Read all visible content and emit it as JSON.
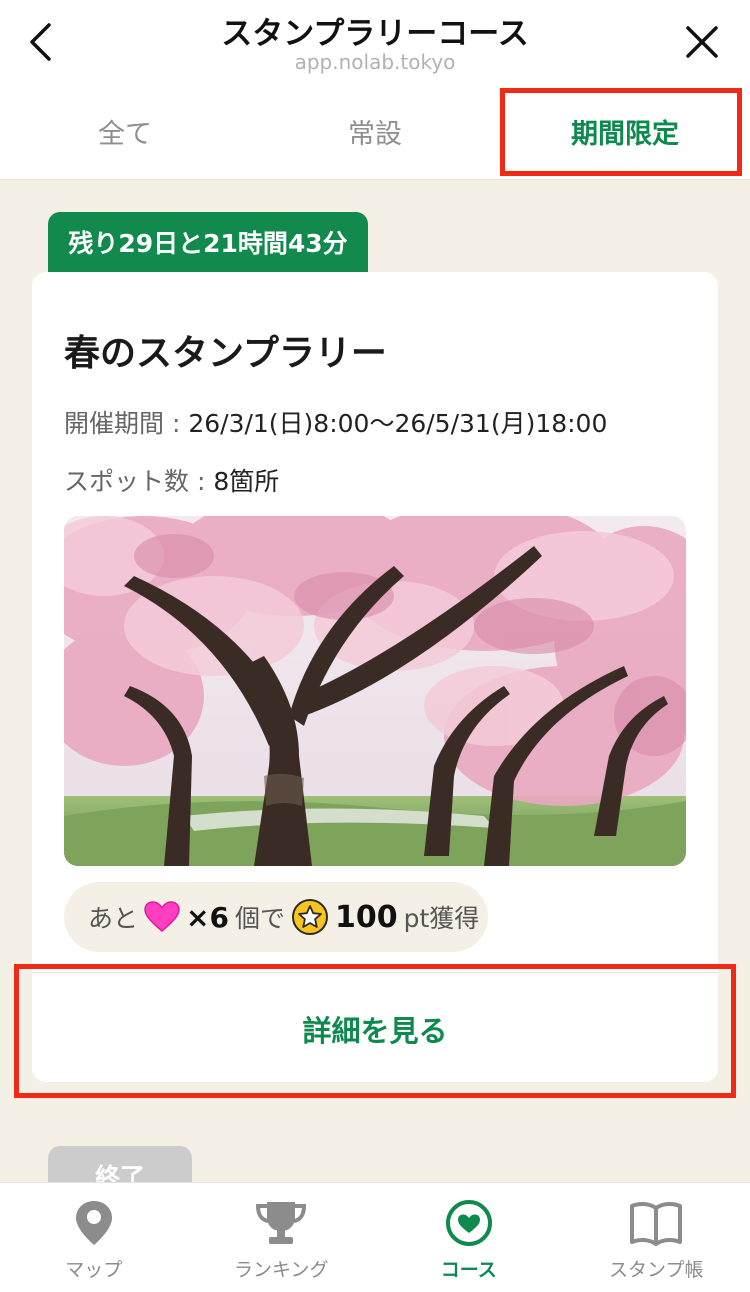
{
  "header": {
    "title": "スタンプラリーコース",
    "url": "app.nolab.tokyo",
    "back_icon": "chevron-left-icon",
    "close_icon": "close-icon"
  },
  "tabs": [
    {
      "label": "全て",
      "active": false
    },
    {
      "label": "常設",
      "active": false
    },
    {
      "label": "期間限定",
      "active": true
    }
  ],
  "course": {
    "remaining": "残り29日と21時間43分",
    "title": "春のスタンプラリー",
    "period_label": "開催期間 : ",
    "period_value": "26/3/1(日)8:00〜26/5/31(月)18:00",
    "spots_label": "スポット数 : ",
    "spots_value": "8箇所",
    "image": "cherry-blossom-trees-photo",
    "reward": {
      "prefix": "あと",
      "heart_count": "×6",
      "middle": "個で",
      "points": "100",
      "suffix": "pt獲得"
    },
    "details_button": "詳細を見る"
  },
  "next_course": {
    "status": "終了"
  },
  "bottom_nav": [
    {
      "label": "マップ",
      "icon": "map-pin-icon",
      "active": false
    },
    {
      "label": "ランキング",
      "icon": "trophy-icon",
      "active": false
    },
    {
      "label": "コース",
      "icon": "heart-circle-icon",
      "active": true
    },
    {
      "label": "スタンプ帳",
      "icon": "book-icon",
      "active": false
    }
  ],
  "colors": {
    "accent_green": "#0f8a4f",
    "badge_green": "#128a4e",
    "background": "#f5f0e6",
    "highlight_red": "#f02a14",
    "heart_pink": "#ff3fc0",
    "coin_yellow": "#f7c51d"
  }
}
